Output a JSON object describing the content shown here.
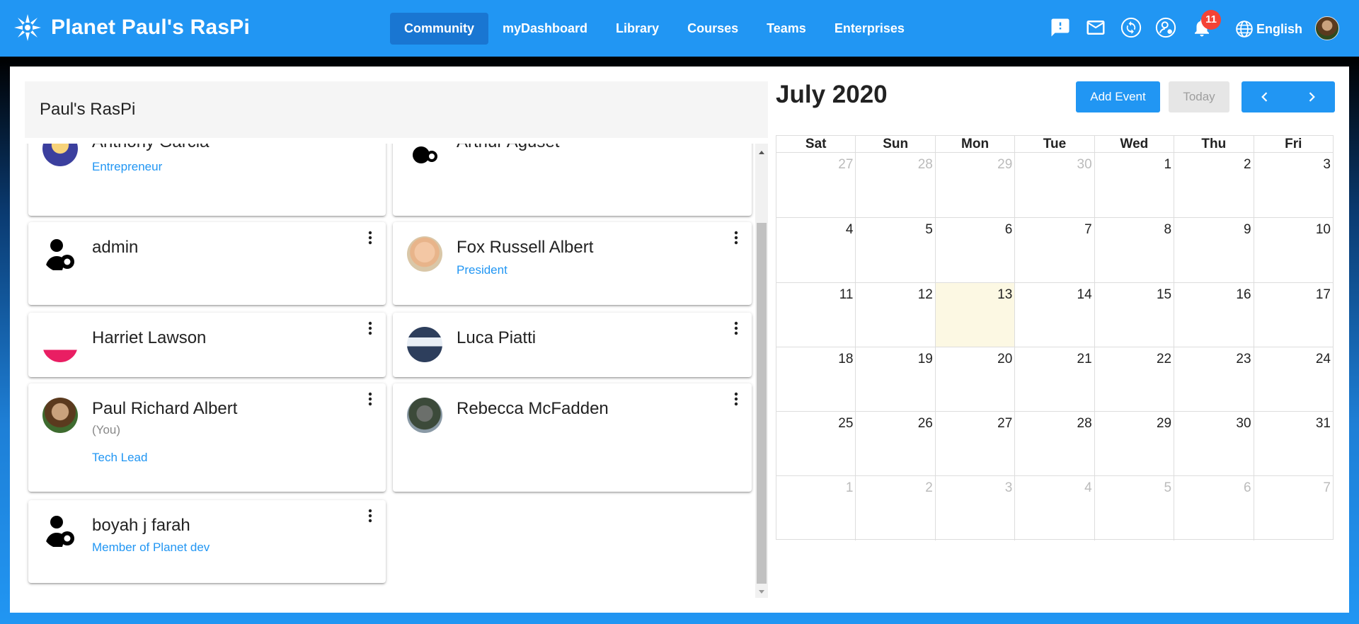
{
  "app": {
    "brand": "Planet Paul's RasPi",
    "nav": [
      "Community",
      "myDashboard",
      "Library",
      "Courses",
      "Teams",
      "Enterprises"
    ],
    "active_nav": "Community",
    "notification_count": "11",
    "language": "English",
    "colors": {
      "primary": "#2196f3",
      "active_nav": "#1976d2",
      "badge": "#f44336",
      "link": "#2196f3",
      "today_highlight": "#fcf8e3"
    },
    "icons": [
      "feedback-icon",
      "mail-icon",
      "sync-icon",
      "admin-user-icon",
      "notification-bell-icon",
      "language-globe-icon"
    ]
  },
  "members_panel": {
    "title": "Paul's RasPi",
    "members": [
      {
        "name": "Anthony Garcia",
        "role": "Entrepreneur",
        "you": ""
      },
      {
        "name": "Arthur Aguset",
        "role": "",
        "you": ""
      },
      {
        "name": "admin",
        "role": "",
        "you": ""
      },
      {
        "name": "Fox Russell Albert",
        "role": "President",
        "you": ""
      },
      {
        "name": "Harriet Lawson",
        "role": "",
        "you": ""
      },
      {
        "name": "Luca Piatti",
        "role": "",
        "you": ""
      },
      {
        "name": "Paul Richard Albert",
        "role": "Tech Lead",
        "you": "(You)"
      },
      {
        "name": "Rebecca McFadden",
        "role": "",
        "you": ""
      },
      {
        "name": "boyah j farah",
        "role": "Member of Planet dev",
        "you": ""
      }
    ]
  },
  "calendar": {
    "title": "July 2020",
    "add_event": "Add Event",
    "today": "Today",
    "weekdays": [
      "Sat",
      "Sun",
      "Mon",
      "Tue",
      "Wed",
      "Thu",
      "Fri"
    ],
    "weeks": [
      [
        "27",
        "28",
        "29",
        "30",
        "1",
        "2",
        "3"
      ],
      [
        "4",
        "5",
        "6",
        "7",
        "8",
        "9",
        "10"
      ],
      [
        "11",
        "12",
        "13",
        "14",
        "15",
        "16",
        "17"
      ],
      [
        "18",
        "19",
        "20",
        "21",
        "22",
        "23",
        "24"
      ],
      [
        "25",
        "26",
        "27",
        "28",
        "29",
        "30",
        "31"
      ],
      [
        "1",
        "2",
        "3",
        "4",
        "5",
        "6",
        "7"
      ]
    ],
    "other_month": [
      [
        true,
        true,
        true,
        true,
        false,
        false,
        false
      ],
      [
        false,
        false,
        false,
        false,
        false,
        false,
        false
      ],
      [
        false,
        false,
        false,
        false,
        false,
        false,
        false
      ],
      [
        false,
        false,
        false,
        false,
        false,
        false,
        false
      ],
      [
        false,
        false,
        false,
        false,
        false,
        false,
        false
      ],
      [
        true,
        true,
        true,
        true,
        true,
        true,
        true
      ]
    ],
    "today_date": "13"
  }
}
